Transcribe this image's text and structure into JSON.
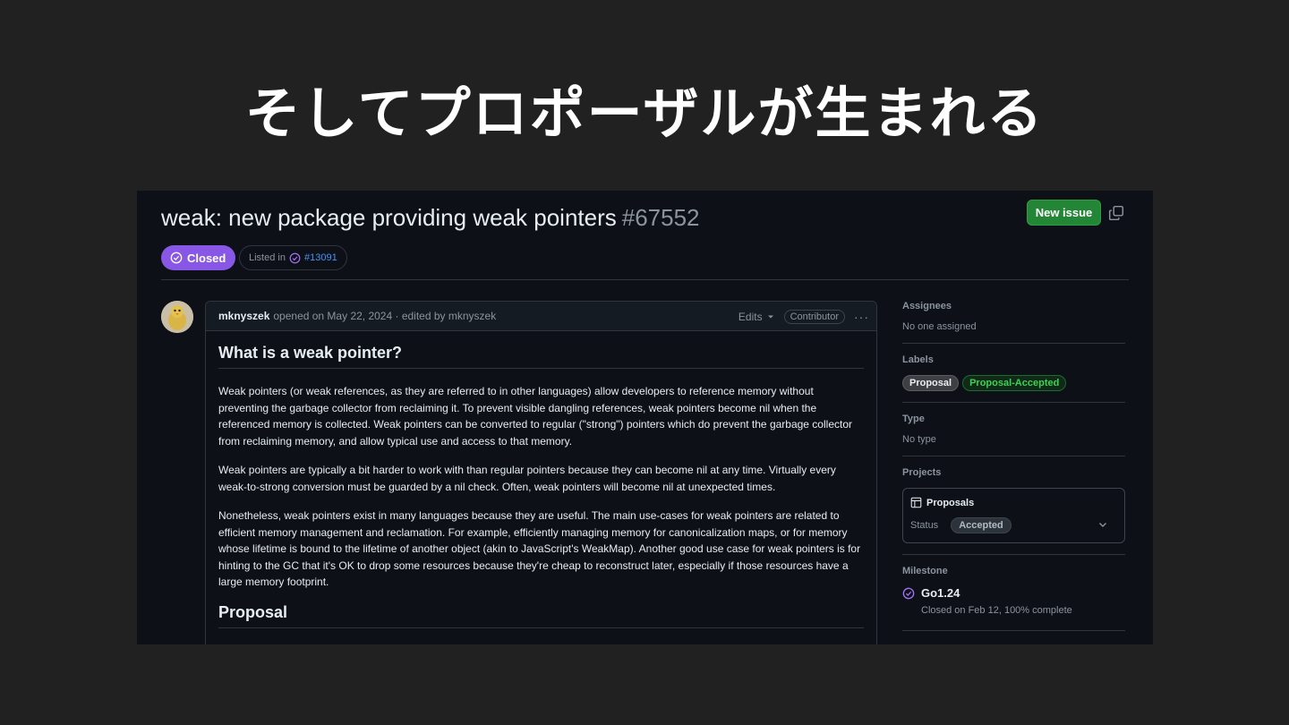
{
  "slide": {
    "title": "そしてプロポーザルが生まれる"
  },
  "issue": {
    "title": "weak: new package providing weak pointers",
    "number": "#67552",
    "state": "Closed",
    "listed_in_label": "Listed in",
    "listed_in_ref": "#13091"
  },
  "toolbar": {
    "new_issue_label": "New issue"
  },
  "comment": {
    "author": "mknyszek",
    "meta": "opened on May 22, 2024 · edited by mknyszek",
    "edits_label": "Edits",
    "role_badge": "Contributor",
    "heading1": "What is a weak pointer?",
    "paragraphs": [
      "Weak pointers (or weak references, as they are referred to in other languages) allow developers to reference memory without preventing the garbage collector from reclaiming it. To prevent visible dangling references, weak pointers become nil when the referenced memory is collected. Weak pointers can be converted to regular (\"strong\") pointers which do prevent the garbage collector from reclaiming memory, and allow typical use and access to that memory.",
      "Weak pointers are typically a bit harder to work with than regular pointers because they can become nil at any time. Virtually every weak-to-strong conversion must be guarded by a nil check. Often, weak pointers will become nil at unexpected times.",
      "Nonetheless, weak pointers exist in many languages because they are useful. The main use-cases for weak pointers are related to efficient memory management and reclamation. For example, efficiently managing memory for canonicalization maps, or for memory whose lifetime is bound to the lifetime of another object (akin to JavaScript's WeakMap). Another good use case for weak pointers is for hinting to the GC that it's OK to drop some resources because they're cheap to reconstruct later, especially if those resources have a large memory footprint."
    ],
    "heading2": "Proposal"
  },
  "sidebar": {
    "assignees": {
      "heading": "Assignees",
      "value": "No one assigned"
    },
    "labels": {
      "heading": "Labels",
      "items": [
        "Proposal",
        "Proposal-Accepted"
      ]
    },
    "type": {
      "heading": "Type",
      "value": "No type"
    },
    "projects": {
      "heading": "Projects",
      "project_name": "Proposals",
      "status_label": "Status",
      "status_value": "Accepted"
    },
    "milestone": {
      "heading": "Milestone",
      "name": "Go1.24",
      "detail": "Closed on Feb 12, 100% complete"
    }
  },
  "colors": {
    "closed": "#8957e5",
    "new_issue": "#238636",
    "link": "#4493f8",
    "accepted_label": "#3fd156"
  },
  "icons": [
    "copy-icon",
    "check-circle-icon",
    "chevron-down-icon",
    "kebab-icon",
    "table-icon",
    "milestone-icon"
  ]
}
